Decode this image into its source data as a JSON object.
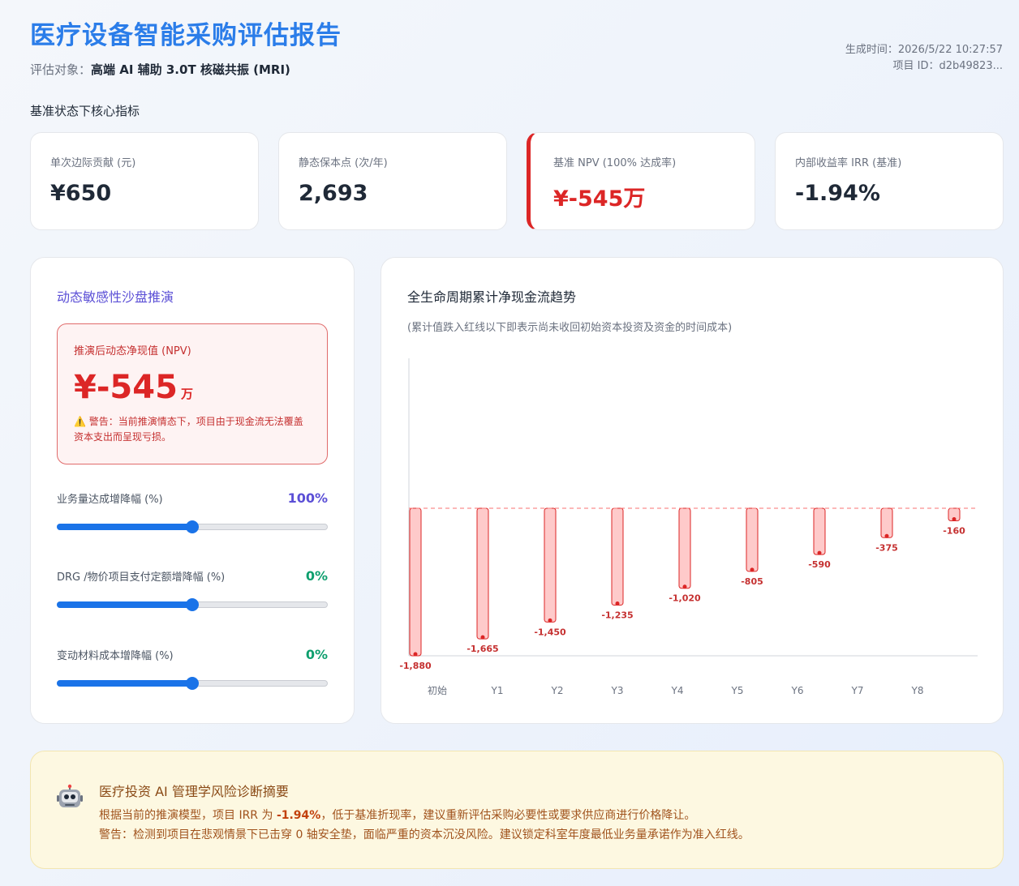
{
  "header": {
    "title": "医疗设备智能采购评估报告",
    "subject_label": "评估对象：",
    "subject_value": "高端 AI 辅助 3.0T 核磁共振 (MRI)",
    "generated_time": "生成时间：2026/5/22 10:27:57",
    "project_id": "项目 ID：d2b49823..."
  },
  "section_title": "基准状态下核心指标",
  "kpis": [
    {
      "label": "单次边际贡献 (元)",
      "value": "¥650"
    },
    {
      "label": "静态保本点 (次/年)",
      "value": "2,693"
    },
    {
      "label": "基准 NPV (100% 达成率)",
      "value": "¥-545万",
      "status": "alert"
    },
    {
      "label": "内部收益率 IRR (基准)",
      "value": "-1.94%"
    }
  ],
  "sandbox": {
    "title": "动态敏感性沙盘推演",
    "npv_label": "推演后动态净现值 (NPV)",
    "npv_value": "¥-545",
    "npv_unit": "万",
    "warning": "⚠️ 警告：当前推演情态下，项目由于现金流无法覆盖资本支出而呈现亏损。",
    "sliders": [
      {
        "label": "业务量达成增降幅 (%)",
        "value": "100%",
        "level": 0.5,
        "color": "#5b4fd6"
      },
      {
        "label": "DRG /物价项目支付定额增降幅 (%)",
        "value": "0%",
        "level": 0.5,
        "color": "#0e9f6e"
      },
      {
        "label": "变动材料成本增降幅 (%)",
        "value": "0%",
        "level": 0.5,
        "color": "#0e9f6e"
      }
    ]
  },
  "chart": {
    "title": "全生命周期累计净现金流趋势",
    "subtitle": "(累计值跌入红线以下即表示尚未收回初始资本投资及资金的时间成本)"
  },
  "chart_data": {
    "type": "bar",
    "categories": [
      "初始",
      "Y1",
      "Y2",
      "Y3",
      "Y4",
      "Y5",
      "Y6",
      "Y7",
      "Y8"
    ],
    "values": [
      -1880,
      -1665,
      -1450,
      -1235,
      -1020,
      -805,
      -590,
      -375,
      -160
    ],
    "data_labels": [
      "-1,880",
      "-1,665",
      "-1,450",
      "-1,235",
      "-1,020",
      "-805",
      "-590",
      "-375",
      "-160"
    ],
    "reference_line": 0,
    "ylim": [
      -1880,
      0
    ],
    "grid": false,
    "legend": "none",
    "colors": {
      "bar_fill": "#fecaca",
      "bar_stroke": "#dc2626",
      "reference": "#f87171",
      "label": "#c53030"
    }
  },
  "summary": {
    "icon": "robot-icon",
    "title": "医疗投资 AI 管理学风险诊断摘要",
    "line1_prefix": "根据当前的推演模型，项目 IRR 为 ",
    "line1_highlight": "-1.94%",
    "line1_suffix": "，低于基准折现率，建议重新评估采购必要性或要求供应商进行价格降让。",
    "line2": "警告：检测到项目在悲观情景下已击穿 0 轴安全垫，面临严重的资本沉没风险。建议锁定科室年度最低业务量承诺作为准入红线。"
  }
}
